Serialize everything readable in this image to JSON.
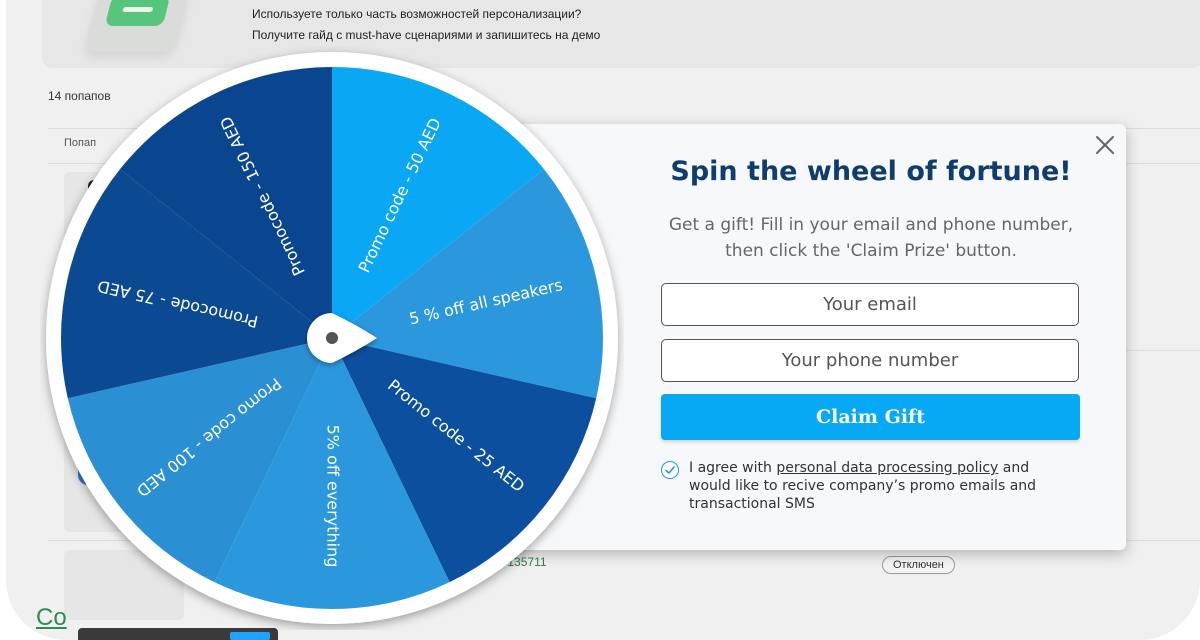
{
  "background": {
    "banner": {
      "line1": "Используете только часть возможностей персонализации?",
      "line2": "Получите гайд с must-have сценариями и запишитесь на демо"
    },
    "popups_count": "14 попапов",
    "table": {
      "column_popup": "Попап"
    },
    "row": {
      "name_partial": "ие #135711",
      "status": "Отключен"
    },
    "bottom_link_partial": "Со"
  },
  "popup": {
    "title": "Spin the wheel of fortune!",
    "subtitle": "Get a gift! Fill in your email and phone number, then click the 'Claim Prize' button.",
    "email_placeholder": "Your email",
    "phone_placeholder": "Your phone number",
    "claim_button": "Claim Gift",
    "consent": {
      "checked": true,
      "prefix": "I agree with ",
      "link": "personal data processing policy",
      "suffix": " and would like to recive company’s promo emails and transactional SMS"
    },
    "close_icon": "close-icon"
  },
  "wheel": {
    "segments": [
      {
        "label": "Promo code - 50 AED",
        "color": "#0aa7f5"
      },
      {
        "label": "5 % off all speakers",
        "color": "#2b98de"
      },
      {
        "label": "Promo code - 25 AED",
        "color": "#0d4f9f"
      },
      {
        "label": "5% off everything",
        "color": "#2b98de"
      },
      {
        "label": "Promo code - 100 AED",
        "color": "#2b8fd4"
      },
      {
        "label": "Promocode - 75 AED",
        "color": "#0b4a93"
      },
      {
        "label": "Promocode - 150 AED",
        "color": "#0a4690"
      }
    ],
    "pointer_icon": "wheel-pointer-icon",
    "rim_color": "#ffffff"
  },
  "colors": {
    "title": "#0f3e6e",
    "button": "#08a9f4",
    "accent_check": "#1d9be8"
  }
}
